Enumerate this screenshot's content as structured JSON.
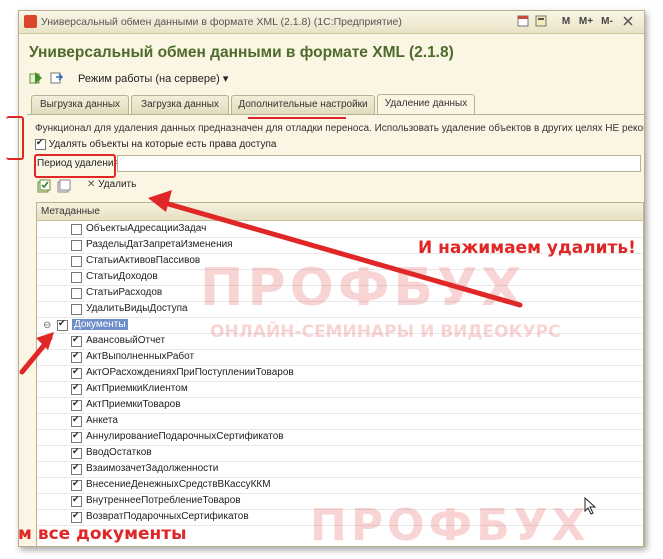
{
  "window": {
    "title": "Универсальный обмен данными в формате XML (2.1.8)  (1С:Предприятие)",
    "controls": [
      "M",
      "M+",
      "M-"
    ]
  },
  "header": {
    "title": "Универсальный обмен данными в формате XML (2.1.8)"
  },
  "toolbar": {
    "mode_label": "Режим работы (на сервере)"
  },
  "tabs": [
    {
      "label": "Выгрузка данных",
      "active": false
    },
    {
      "label": "Загрузка данных",
      "active": false
    },
    {
      "label": "Дополнительные настройки",
      "active": false
    },
    {
      "label": "Удаление данных",
      "active": true
    }
  ],
  "panel": {
    "info_text": "Функционал для удаления данных предназначен для отладки переноса. Использовать удаление объектов в других целях НЕ рекомендуется.",
    "checkbox_label": "Удалять объекты на которые есть права доступа",
    "checkbox_checked": true,
    "period_label": "Период удаления:",
    "period_value": "",
    "delete_label": "Удалить"
  },
  "grid": {
    "column_header": "Метаданные",
    "rows": [
      {
        "label": "ОбъектыАдресацииЗадач",
        "checked": false,
        "level": 2
      },
      {
        "label": "РазделыДатЗапретаИзменения",
        "checked": false,
        "level": 2
      },
      {
        "label": "СтатьиАктивовПассивов",
        "checked": false,
        "level": 2
      },
      {
        "label": "СтатьиДоходов",
        "checked": false,
        "level": 2
      },
      {
        "label": "СтатьиРасходов",
        "checked": false,
        "level": 2
      },
      {
        "label": "УдалитьВидыДоступа",
        "checked": false,
        "level": 2
      },
      {
        "label": "Документы",
        "checked": true,
        "level": 1,
        "selected": true,
        "group": true
      },
      {
        "label": "АвансовыйОтчет",
        "checked": true,
        "level": 2
      },
      {
        "label": "АктВыполненныхРабот",
        "checked": true,
        "level": 2
      },
      {
        "label": "АктОРасхожденияхПриПоступленииТоваров",
        "checked": true,
        "level": 2
      },
      {
        "label": "АктПриемкиКлиентом",
        "checked": true,
        "level": 2
      },
      {
        "label": "АктПриемкиТоваров",
        "checked": true,
        "level": 2
      },
      {
        "label": "Анкета",
        "checked": true,
        "level": 2
      },
      {
        "label": "АннулированиеПодарочныхСертификатов",
        "checked": true,
        "level": 2
      },
      {
        "label": "ВводОстатков",
        "checked": true,
        "level": 2
      },
      {
        "label": "ВзаимозачетЗадолженности",
        "checked": true,
        "level": 2
      },
      {
        "label": "ВнесениеДенежныхСредствВКассуККМ",
        "checked": true,
        "level": 2
      },
      {
        "label": "ВнутреннееПотреблениеТоваров",
        "checked": true,
        "level": 2
      },
      {
        "label": "ВозвратПодарочныхСертификатов",
        "checked": true,
        "level": 2
      }
    ]
  },
  "annotations": {
    "click_delete": "И нажимаем удалить!",
    "all_documents": "м все документы"
  },
  "watermark": {
    "brand": "ПРОФБУХ",
    "tagline": "ОНЛАЙН-СЕМИНАРЫ И ВИДЕОКУРС"
  },
  "colors": {
    "accent_red": "#e02626",
    "header_green": "#4d6b2a",
    "selection_blue": "#6e8fc9"
  }
}
